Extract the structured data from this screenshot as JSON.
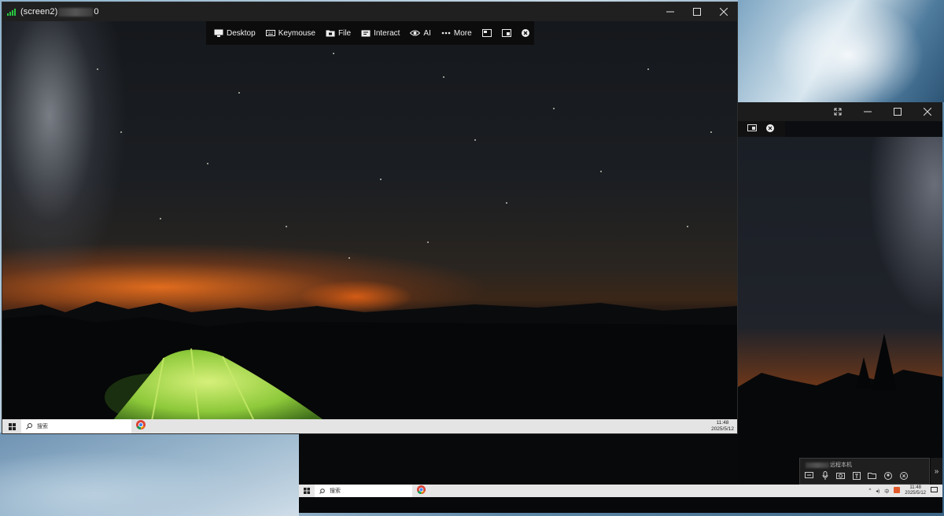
{
  "main_window": {
    "title_prefix": "(screen2)",
    "title_suffix": "0",
    "toolbar": {
      "desktop": "Desktop",
      "keymouse": "Keymouse",
      "file": "File",
      "interact": "Interact",
      "ai": "AI",
      "more": "More"
    },
    "taskbar": {
      "search": "搜索",
      "time": "11:48",
      "date": "2025/5/12"
    }
  },
  "second_window": {
    "panel_label": "远程本机",
    "taskbar": {
      "search": "搜索",
      "time": "11:48",
      "date": "2025/5/12"
    }
  },
  "colors": {
    "signal": "#28c840",
    "toolbar_bg": "#0c0c0c",
    "titlebar_bg": "#202020"
  }
}
